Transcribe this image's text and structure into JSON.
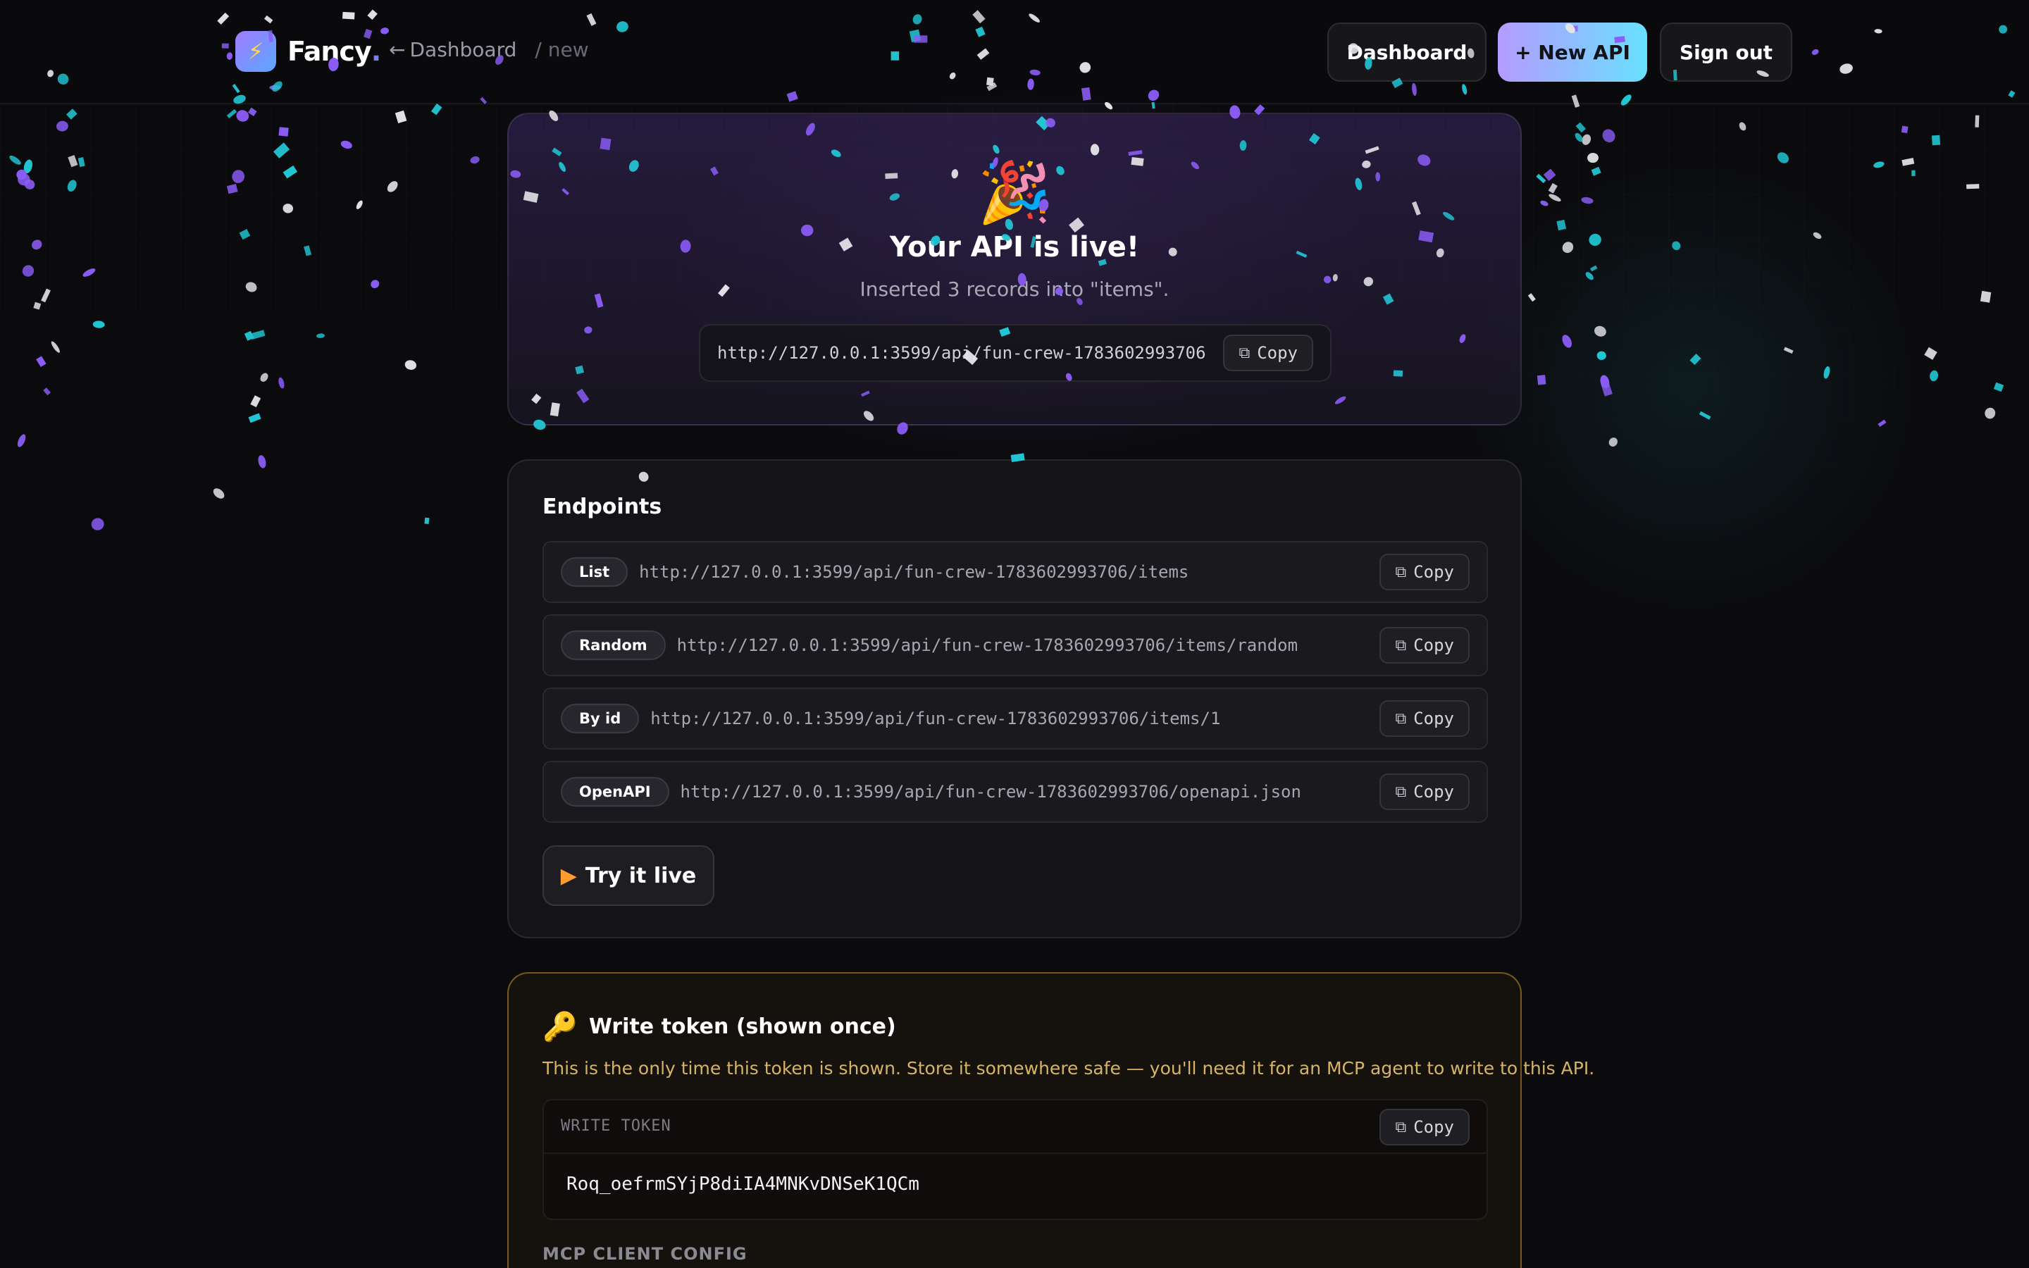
{
  "header": {
    "brand": "Fancy",
    "brand_dot": ".",
    "brand_icon": "lightning-icon",
    "back_arrow": "←",
    "crumb_back": "Dashboard",
    "crumb_current": "/ new",
    "nav": {
      "dashboard": "Dashboard",
      "new_api": "+ New API",
      "sign_out": "Sign out"
    }
  },
  "hero": {
    "emoji": "🎉",
    "title": "Your API is live!",
    "subtitle": "Inserted 3 records into \"items\".",
    "base_url": "http://127.0.0.1:3599/api/fun-crew-1783602993706",
    "copy_label": "Copy"
  },
  "endpoints": {
    "title": "Endpoints",
    "items": [
      {
        "label": "List",
        "url": "http://127.0.0.1:3599/api/fun-crew-1783602993706/items",
        "copy": "Copy"
      },
      {
        "label": "Random",
        "url": "http://127.0.0.1:3599/api/fun-crew-1783602993706/items/random",
        "copy": "Copy"
      },
      {
        "label": "By id",
        "url": "http://127.0.0.1:3599/api/fun-crew-1783602993706/items/1",
        "copy": "Copy"
      },
      {
        "label": "OpenAPI",
        "url": "http://127.0.0.1:3599/api/fun-crew-1783602993706/openapi.json",
        "copy": "Copy"
      }
    ],
    "try_icon": "▶",
    "try_label": "Try it live"
  },
  "token": {
    "icon": "🔑",
    "title": "Write token (shown once)",
    "note": "This is the only time this token is shown. Store it somewhere safe — you'll need it for an MCP agent to write to this API.",
    "label": "WRITE TOKEN",
    "copy": "Copy",
    "value": "Roq_oefrmSYjP8diIA4MNKvDNSeK1QCm",
    "mcp_label": "MCP CLIENT CONFIG"
  },
  "colors": {
    "accent_purple": "#8b5cf6",
    "accent_cyan": "#22c7d6",
    "warning_gold": "#d6b463",
    "confetti": [
      "#8b5cf6",
      "#22c7d6",
      "#e6e6ea"
    ]
  }
}
